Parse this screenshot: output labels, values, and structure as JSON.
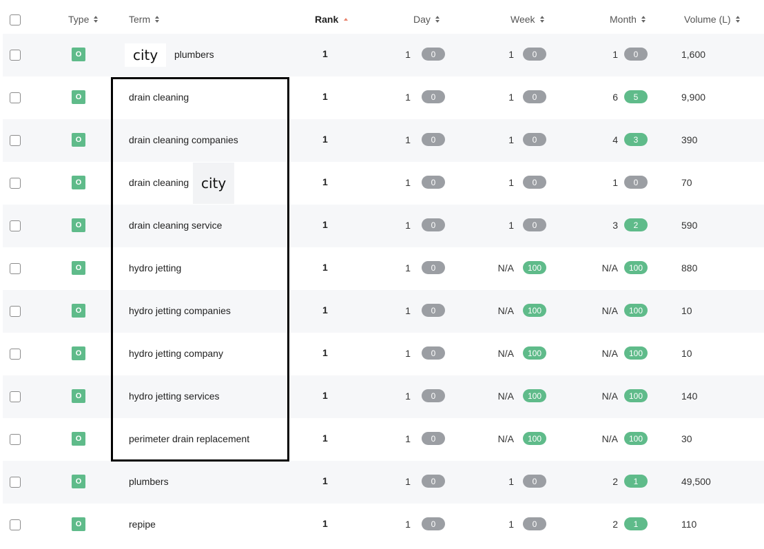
{
  "header": {
    "type": "Type",
    "term": "Term",
    "rank": "Rank",
    "day": "Day",
    "week": "Week",
    "month": "Month",
    "volume": "Volume (L)"
  },
  "rows": [
    {
      "type": "O",
      "term": "plumbers",
      "rank": "1",
      "day": "1",
      "day_change": "0",
      "week": "1",
      "week_change": "0",
      "month": "1",
      "month_change": "0",
      "volume": "1,600",
      "overlay": "city"
    },
    {
      "type": "O",
      "term": "drain cleaning",
      "rank": "1",
      "day": "1",
      "day_change": "0",
      "week": "1",
      "week_change": "0",
      "month": "6",
      "month_change": "5",
      "volume": "9,900"
    },
    {
      "type": "O",
      "term": "drain cleaning companies",
      "rank": "1",
      "day": "1",
      "day_change": "0",
      "week": "1",
      "week_change": "0",
      "month": "4",
      "month_change": "3",
      "volume": "390"
    },
    {
      "type": "O",
      "term": "drain cleaning",
      "rank": "1",
      "day": "1",
      "day_change": "0",
      "week": "1",
      "week_change": "0",
      "month": "1",
      "month_change": "0",
      "volume": "70",
      "overlay": "city"
    },
    {
      "type": "O",
      "term": "drain cleaning service",
      "rank": "1",
      "day": "1",
      "day_change": "0",
      "week": "1",
      "week_change": "0",
      "month": "3",
      "month_change": "2",
      "volume": "590"
    },
    {
      "type": "O",
      "term": "hydro jetting",
      "rank": "1",
      "day": "1",
      "day_change": "0",
      "week": "N/A",
      "week_change": "100",
      "month": "N/A",
      "month_change": "100",
      "volume": "880"
    },
    {
      "type": "O",
      "term": "hydro jetting companies",
      "rank": "1",
      "day": "1",
      "day_change": "0",
      "week": "N/A",
      "week_change": "100",
      "month": "N/A",
      "month_change": "100",
      "volume": "10"
    },
    {
      "type": "O",
      "term": "hydro jetting company",
      "rank": "1",
      "day": "1",
      "day_change": "0",
      "week": "N/A",
      "week_change": "100",
      "month": "N/A",
      "month_change": "100",
      "volume": "10"
    },
    {
      "type": "O",
      "term": "hydro jetting services",
      "rank": "1",
      "day": "1",
      "day_change": "0",
      "week": "N/A",
      "week_change": "100",
      "month": "N/A",
      "month_change": "100",
      "volume": "140"
    },
    {
      "type": "O",
      "term": "perimeter drain replacement",
      "rank": "1",
      "day": "1",
      "day_change": "0",
      "week": "N/A",
      "week_change": "100",
      "month": "N/A",
      "month_change": "100",
      "volume": "30"
    },
    {
      "type": "O",
      "term": "plumbers",
      "rank": "1",
      "day": "1",
      "day_change": "0",
      "week": "1",
      "week_change": "0",
      "month": "2",
      "month_change": "1",
      "volume": "49,500"
    },
    {
      "type": "O",
      "term": "repipe",
      "rank": "1",
      "day": "1",
      "day_change": "0",
      "week": "1",
      "week_change": "0",
      "month": "2",
      "month_change": "1",
      "volume": "110"
    }
  ],
  "colors": {
    "badge_green": "#5fbb8a",
    "pill_gray": "#9b9ea3",
    "sort_active": "#e8826b",
    "stripe": "#f6f7f9"
  }
}
